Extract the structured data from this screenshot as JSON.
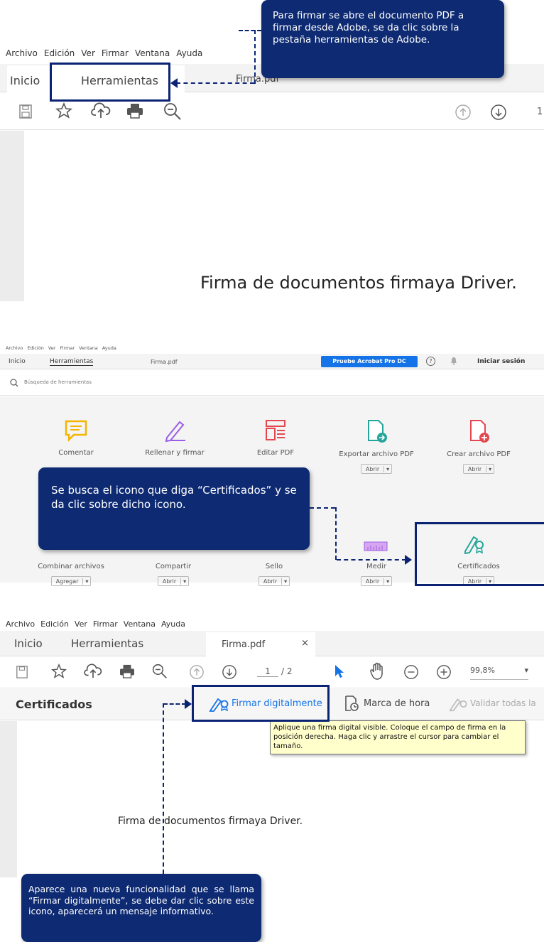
{
  "colors": {
    "callout": "#0d2a73",
    "highlight": "#0b2373",
    "acrobat_button": "#1473e6",
    "tooltip_bg": "#ffffcc"
  },
  "section1": {
    "menu": [
      "Archivo",
      "Edición",
      "Ver",
      "Firmar",
      "Ventana",
      "Ayuda"
    ],
    "tabs": {
      "home": "Inicio",
      "tools": "Herramientas",
      "document": "Firma.pdf"
    },
    "page_number": "1",
    "doc_text": "Firma de documentos firmaya Driver.",
    "callout": "Para firmar se abre el documento PDF a firmar desde Adobe, se da clic sobre la pestaña herramientas de Adobe."
  },
  "section2": {
    "menu": [
      "Archivo",
      "Edición",
      "Ver",
      "Firmar",
      "Ventana",
      "Ayuda"
    ],
    "tabs": {
      "home": "Inicio",
      "tools": "Herramientas",
      "document": "Firma.pdf"
    },
    "try_button": "Pruebe Acrobat Pro DC",
    "help_icon": "?",
    "sign_in": "Iniciar sesión",
    "search_placeholder": "Búsqueda de herramientas",
    "tools_row1": [
      {
        "label": "Comentar",
        "icon": "comment-icon"
      },
      {
        "label": "Rellenar y firmar",
        "icon": "fill-sign-icon"
      },
      {
        "label": "Editar PDF",
        "icon": "edit-pdf-icon"
      },
      {
        "label": "Exportar archivo PDF",
        "button": "Abrir",
        "icon": "export-pdf-icon"
      },
      {
        "label": "Crear archivo PDF",
        "button": "Abrir",
        "icon": "create-pdf-icon"
      }
    ],
    "tools_row2": [
      {
        "label": "Combinar archivos",
        "button": "Agregar"
      },
      {
        "label": "Compartir",
        "button": "Abrir"
      },
      {
        "label": "Sello",
        "button": "Abrir"
      },
      {
        "label": "Medir",
        "button": "Abrir"
      },
      {
        "label": "Certificados",
        "button": "Abrir"
      }
    ],
    "callout": "Se busca el icono que diga “Certificados” y se da clic sobre dicho icono."
  },
  "section3": {
    "menu": [
      "Archivo",
      "Edición",
      "Ver",
      "Firmar",
      "Ventana",
      "Ayuda"
    ],
    "tabs": {
      "home": "Inicio",
      "tools": "Herramientas",
      "document": "Firma.pdf",
      "close": "×"
    },
    "page_current": "1",
    "page_total": "/ 2",
    "zoom": "99,8%",
    "panel_title": "Certificados",
    "sign_digitally": "Firmar digitalmente",
    "timestamp": "Marca de hora",
    "validate": "Validar todas la",
    "tooltip": "Aplique una firma digital visible. Coloque el campo de firma en la posición derecha. Haga clic y arrastre el cursor para cambiar el tamaño.",
    "doc_text": "Firma de documentos firmaya Driver.",
    "callout": "Aparece una nueva funcionalidad que se llama “Firmar digitalmente”, se debe dar clic sobre este icono, aparecerá un mensaje informativo."
  }
}
